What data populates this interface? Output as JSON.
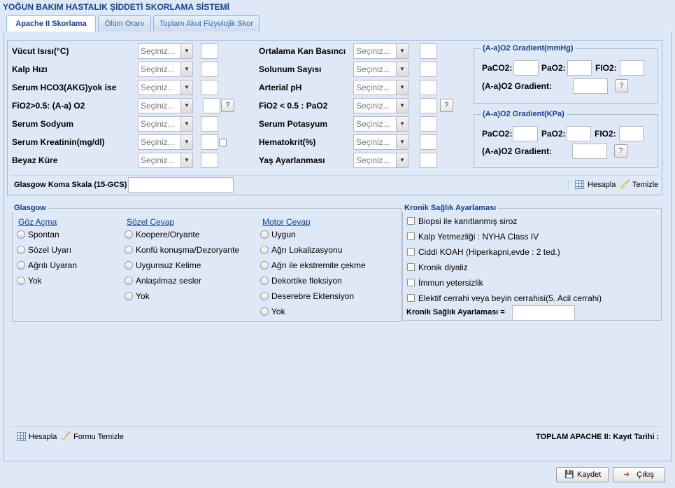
{
  "app_title": "YOĞUN BAKIM HASTALIK ŞİDDETİ SKORLAMA SİSTEMİ",
  "tabs": [
    "Apache II Skorlama",
    "Ölüm Oranı",
    "Toplam Akut Fizyolojik Skor"
  ],
  "select_placeholder": "Seçiniz...",
  "left_fields": [
    "Vücut Isısı(°C)",
    "Kalp Hızı",
    "Serum HCO3(AKG)yok ise",
    "FiO2>0.5: (A-a) O2",
    "Serum Sodyum",
    "Serum Kreatinin(mg/dl)",
    "Beyaz Küre"
  ],
  "mid_fields": [
    "Ortalama Kan Basıncı",
    "Solunum Sayısı",
    "Arterial pH",
    "FiO2 < 0.5 : PaO2",
    "Serum Potasyum",
    "Hematokrit(%)",
    "Yaş Ayarlanması"
  ],
  "help_btn": "?",
  "gradient_mmhg": {
    "legend": "(A-a)O2 Gradient(mmHg)",
    "paco2": "PaCO2:",
    "pao2": "PaO2:",
    "fio2": "FIO2:",
    "gradient": "(A-a)O2 Gradient:"
  },
  "gradient_kpa": {
    "legend": "(A-a)O2 Gradient(KPa)",
    "paco2": "PaCO2:",
    "pao2": "PaO2:",
    "fio2": "FIO2:",
    "gradient": "(A-a)O2 Gradient:"
  },
  "gcs_label": "Glasgow Koma Skala (15-GCS)",
  "toolbar": {
    "calc": "Hesapla",
    "clear": "Temizle"
  },
  "glasgow": {
    "legend": "Glasgow",
    "eye_title": "Göz Açma",
    "eye": [
      "Spontan",
      "Sözel Uyarı",
      "Ağrılı Uyaran",
      "Yok"
    ],
    "verbal_title": "Sözel Cevap",
    "verbal": [
      "Koopere/Oryante",
      "Konfü konuşma/Dezoryante",
      "Uygunsuz Kelime",
      "Anlaşılmaz sesler",
      "Yok"
    ],
    "motor_title": "Motor Cevap",
    "motor": [
      "Uygun",
      "Ağrı Lokalizasyonu",
      "Ağrı ile ekstremite çekme",
      "Dekortike fleksiyon",
      "Deserebre Ektensiyon",
      "Yok"
    ]
  },
  "chronic": {
    "legend": "Kronik Sağlık Ayarlaması",
    "items": [
      "Biopsi ile kanıtlanmış siroz",
      "Kalp Yetmezliği : NYHA Class IV",
      "Ciddi KOAH (Hiperkapni,evde : 2 ted.)",
      "Kronik diyaliz",
      "İmmun yetersizlik",
      "Elektif cerrahi veya beyin cerrahisi(5. Acil cerrahi)"
    ],
    "total_label": "Kronik Sağlık Ayarlaması ="
  },
  "bottom": {
    "calc": "Hesapla",
    "clear": "Formu Temizle",
    "total": "TOPLAM APACHE II: Kayıt Tarihi :"
  },
  "footer": {
    "save": "Kaydet",
    "exit": "Çıkış"
  },
  "colors": {
    "accent": "#15428b",
    "panel": "#dfe8f6",
    "border": "#99bbe8"
  }
}
